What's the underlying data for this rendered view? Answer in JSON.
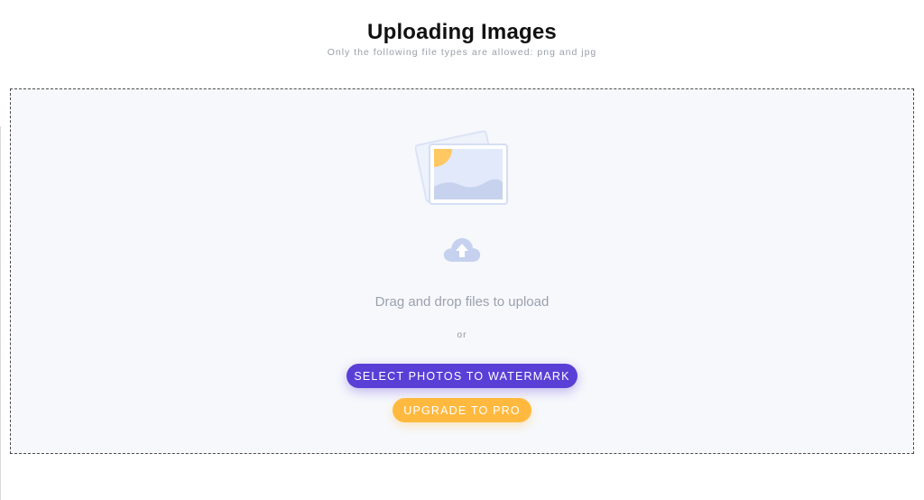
{
  "header": {
    "title": "Uploading Images",
    "subtitle": "Only the following file types are allowed: png and jpg"
  },
  "dropzone": {
    "illustration_icon": "photos-illustration",
    "upload_icon": "upload-cloud-icon",
    "drag_text": "Drag and drop files to upload",
    "or_text": "or"
  },
  "buttons": {
    "select_label": "SELECT PHOTOS TO WATERMARK",
    "upgrade_label": "UPGRADE TO PRO"
  },
  "colors": {
    "primary": "#5a3fd6",
    "accent": "#ffb93f",
    "dropzone_bg": "#f7f8fc",
    "icon_blue": "#c5d1ee"
  }
}
